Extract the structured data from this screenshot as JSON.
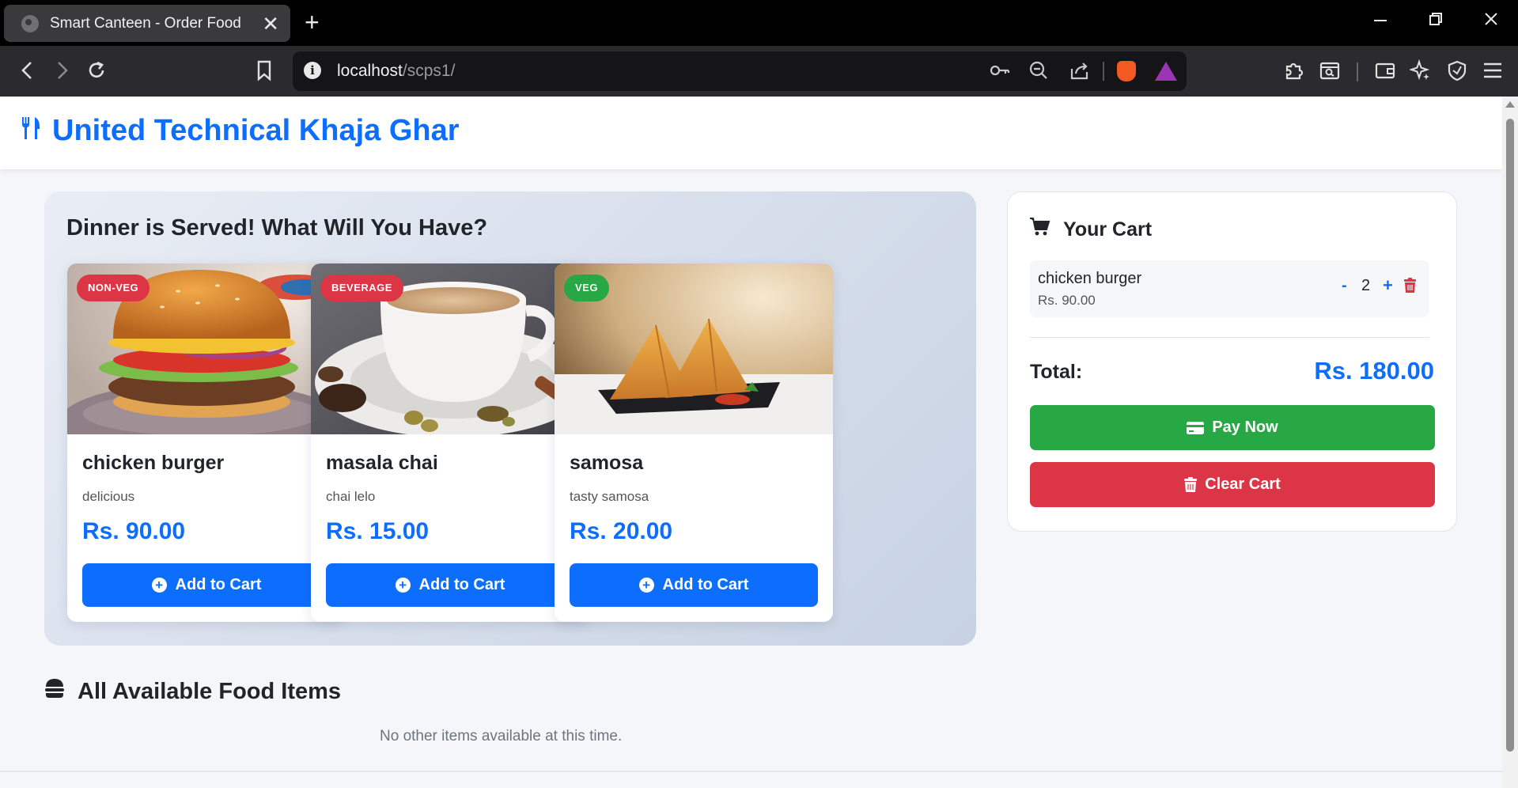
{
  "browser": {
    "tab_title": "Smart Canteen - Order Food",
    "tab_close": "✕",
    "new_tab": "+",
    "url_host": "localhost",
    "url_path": "/scps1/",
    "window_controls": [
      "minimize-icon",
      "restore-icon",
      "close-icon"
    ],
    "toolbar_icons": [
      "back-icon",
      "forward-icon",
      "reload-icon",
      "bookmark-icon",
      "site-info-icon",
      "key-icon",
      "zoom-out-icon",
      "share-icon",
      "brave-shields-icon",
      "brave-rewards-icon",
      "extensions-icon",
      "reader-mode-icon",
      "wallet-icon",
      "leo-ai-icon",
      "vpn-icon",
      "menu-icon"
    ]
  },
  "navbar": {
    "brand": "United Technical Khaja Ghar",
    "brand_icon": "utensils-icon"
  },
  "featured": {
    "title": "Dinner is Served! What Will You Have?",
    "items": [
      {
        "badge": "NON-VEG",
        "badge_color": "#dc3545",
        "name": "chicken burger",
        "description": "delicious",
        "price": "Rs. 90.00",
        "button": "Add to Cart",
        "image": "chicken-burger-photo"
      },
      {
        "badge": "BEVERAGE",
        "badge_color": "#dc3545",
        "name": "masala chai",
        "description": "chai lelo",
        "price": "Rs. 15.00",
        "button": "Add to Cart",
        "image": "masala-chai-photo"
      },
      {
        "badge": "VEG",
        "badge_color": "#28a745",
        "name": "samosa",
        "description": "tasty samosa",
        "price": "Rs. 20.00",
        "button": "Add to Cart",
        "image": "samosa-photo"
      }
    ]
  },
  "all_items": {
    "title": "All Available Food Items",
    "icon": "hamburger-icon",
    "empty_message": "No other items available at this time."
  },
  "cart": {
    "title": "Your Cart",
    "icon": "cart-icon",
    "items": [
      {
        "name": "chicken burger",
        "price": "Rs. 90.00",
        "qty": "2",
        "minus": "-",
        "plus": "+"
      }
    ],
    "total_label": "Total:",
    "total_value": "Rs. 180.00",
    "pay_button": "Pay Now",
    "clear_button": "Clear Cart"
  },
  "colors": {
    "primary": "#0d6efd",
    "success": "#28a745",
    "danger": "#dc3545"
  }
}
